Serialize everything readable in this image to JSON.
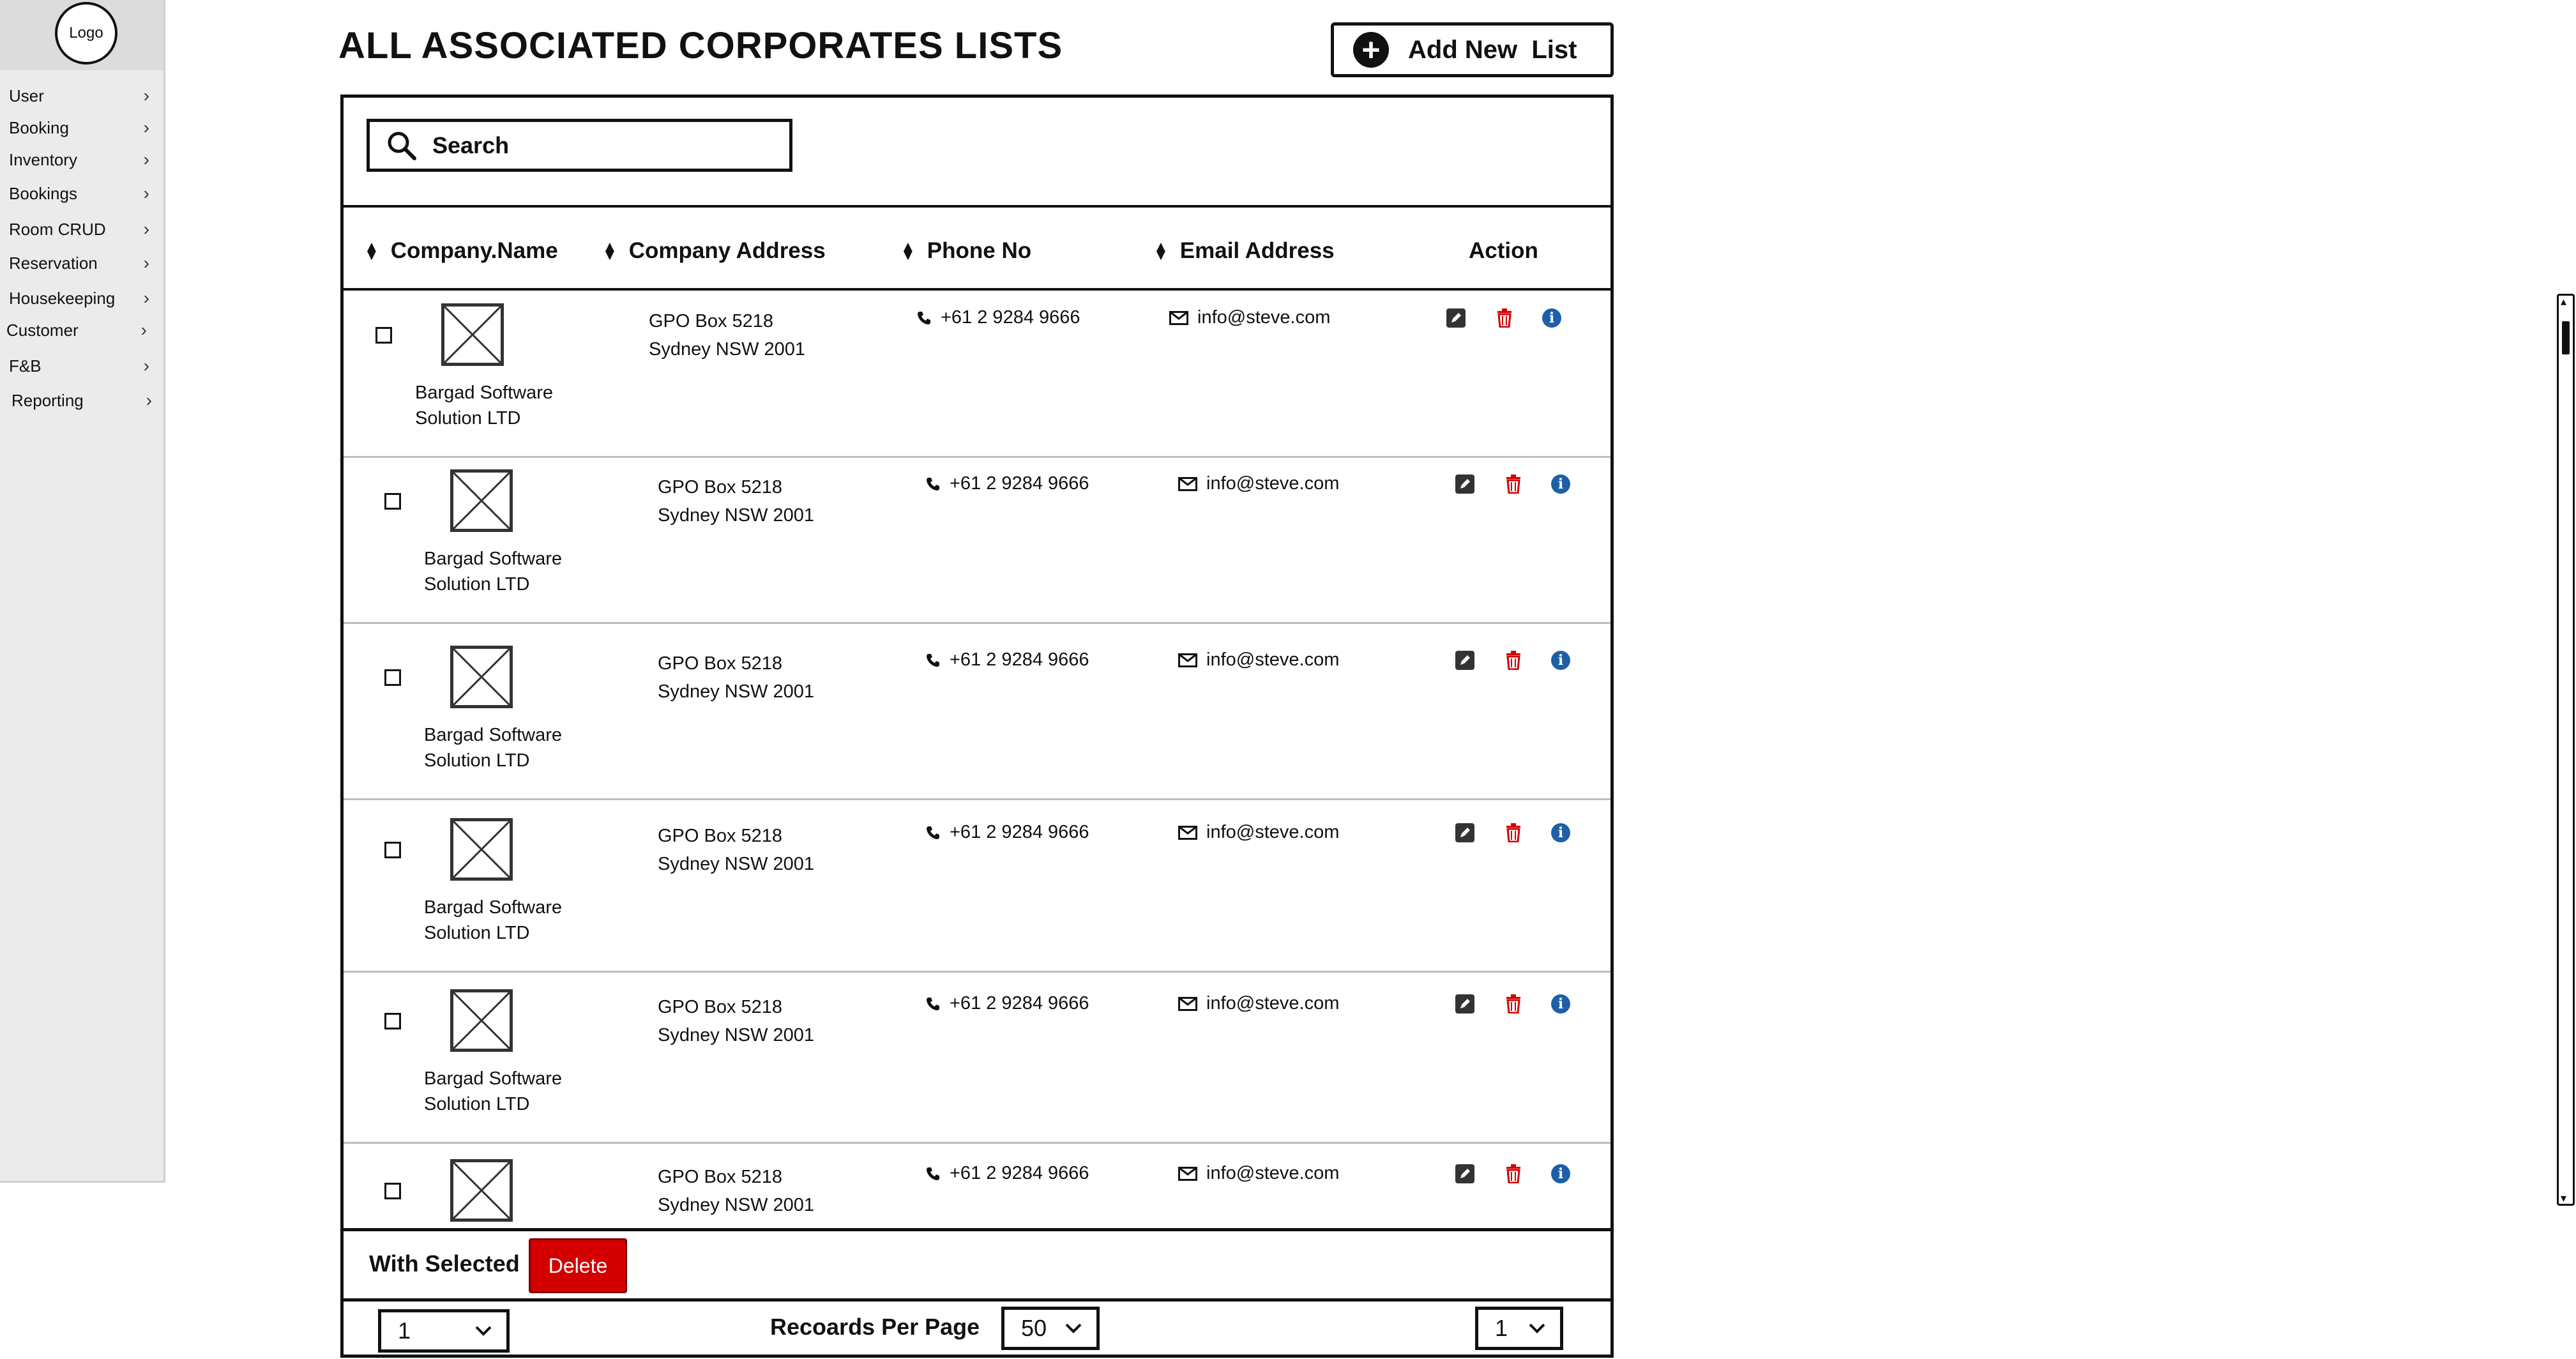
{
  "sidebar": {
    "logo": "Logo",
    "items": [
      {
        "label": "User"
      },
      {
        "label": "Booking"
      },
      {
        "label": "Inventory"
      },
      {
        "label": "Bookings"
      },
      {
        "label": "Room CRUD"
      },
      {
        "label": "Reservation"
      },
      {
        "label": "Housekeeping"
      },
      {
        "label": "Customer"
      },
      {
        "label": "F&B"
      },
      {
        "label": "Reporting"
      }
    ]
  },
  "header": {
    "title": "ALL ASSOCIATED CORPORATES LISTS",
    "add_button_label": "Add New  List"
  },
  "search": {
    "placeholder": "Search"
  },
  "table": {
    "columns": [
      "Company.Name",
      "Company Address",
      "Phone No",
      "Email Address",
      "Action"
    ],
    "rows": [
      {
        "company": "Bargad Software Solution LTD",
        "address_line1": "GPO Box 5218",
        "address_line2": "Sydney NSW 2001",
        "phone": "+61 2 9284 9666",
        "email": "info@steve.com"
      },
      {
        "company": "Bargad Software Solution LTD",
        "address_line1": "GPO Box 5218",
        "address_line2": "Sydney NSW 2001",
        "phone": "+61 2 9284 9666",
        "email": "info@steve.com"
      },
      {
        "company": "Bargad Software Solution LTD",
        "address_line1": "GPO Box 5218",
        "address_line2": "Sydney NSW 2001",
        "phone": "+61 2 9284 9666",
        "email": "info@steve.com"
      },
      {
        "company": "Bargad Software Solution LTD",
        "address_line1": "GPO Box 5218",
        "address_line2": "Sydney NSW 2001",
        "phone": "+61 2 9284 9666",
        "email": "info@steve.com"
      },
      {
        "company": "Bargad Software Solution LTD",
        "address_line1": "GPO Box 5218",
        "address_line2": "Sydney NSW 2001",
        "phone": "+61 2 9284 9666",
        "email": "info@steve.com"
      },
      {
        "company": "",
        "address_line1": "GPO Box 5218",
        "address_line2": "Sydney NSW 2001",
        "phone": "+61 2 9284 9666",
        "email": "info@steve.com"
      }
    ],
    "action_icons": [
      "edit-icon",
      "trash-icon",
      "info-icon"
    ]
  },
  "footer": {
    "with_selected_label": "With Selected",
    "delete_label": "Delete",
    "page_select_value": "1",
    "per_page_label": "Recoards Per Page",
    "per_page_value": "50",
    "page_right_value": "1"
  },
  "colors": {
    "delete": "#d40000",
    "info": "#1d5fa8",
    "sidebar_bg": "#ebebeb"
  }
}
